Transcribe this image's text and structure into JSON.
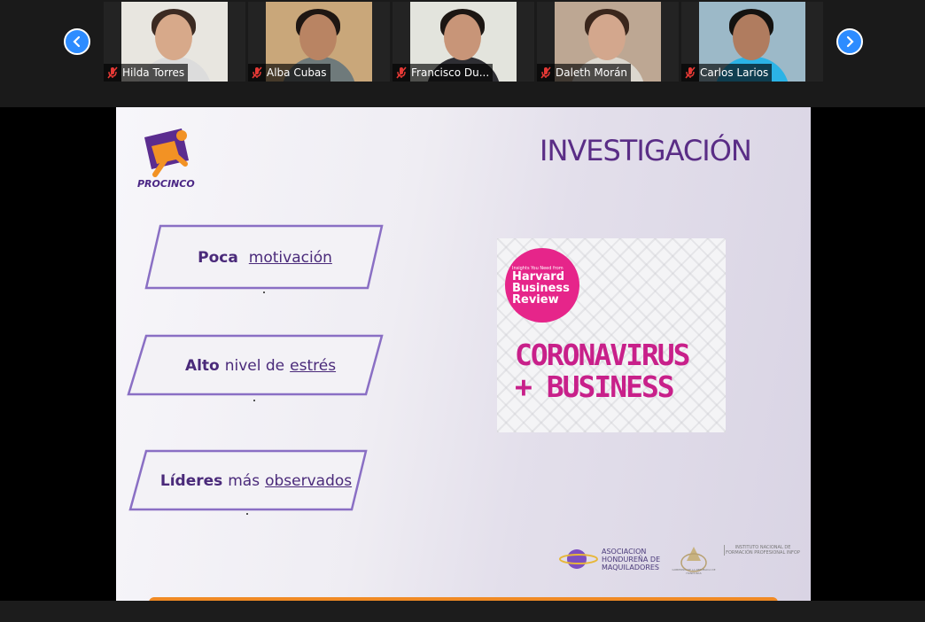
{
  "participants": [
    {
      "name": "Hilda Torres",
      "skin": "#d7a98a",
      "hair": "#3b2a22",
      "shirt": "#dcdcdc",
      "bg": "#e8e6e0"
    },
    {
      "name": "Alba Cubas",
      "skin": "#b98463",
      "hair": "#1e1612",
      "shirt": "#6f7a7b",
      "bg": "#c9a77a"
    },
    {
      "name": "Francisco Du...",
      "skin": "#c89578",
      "hair": "#1c1613",
      "shirt": "#2e2e33",
      "bg": "#e3e4dd"
    },
    {
      "name": "Daleth Morán",
      "skin": "#d3a78d",
      "hair": "#3a261c",
      "shirt": "#dcd8cf",
      "bg": "#bda793"
    },
    {
      "name": "Carlos Larios",
      "skin": "#b07c5f",
      "hair": "#141210",
      "shirt": "#2bb3e6",
      "bg": "#9cb9c8"
    }
  ],
  "slide": {
    "title": "INVESTIGACIÓN",
    "logo_text": "PROCINCO",
    "items": [
      {
        "bold": "Poca",
        "plain": "",
        "underlined": "motivación"
      },
      {
        "bold": "Alto",
        "plain": "nivel de",
        "underlined": "estrés"
      },
      {
        "bold": "Líderes",
        "plain": "más",
        "underlined": "observados"
      }
    ],
    "hbr": {
      "small": "Insights You Need from",
      "name": "Harvard Business Review",
      "headline": "CORONAVIRUS + BUSINESS"
    },
    "sponsor": "ASOCIACION HONDUREÑA DE MAQUILADORES",
    "seal_text": "GOBIERNO DE LA REPÚBLICA DE HONDURAS",
    "infop": "INSTITUTO NACIONAL DE FORMACIÓN PROFESIONAL INFOP"
  },
  "colors": {
    "accent": "#2d8cff",
    "slide_purple": "#5a2d86",
    "hbr_pink": "#e6258a",
    "orange_bar": "#f08a24"
  },
  "icons": {
    "prev": "chevron-left-icon",
    "next": "chevron-right-icon",
    "mic": "mic-off-icon"
  }
}
